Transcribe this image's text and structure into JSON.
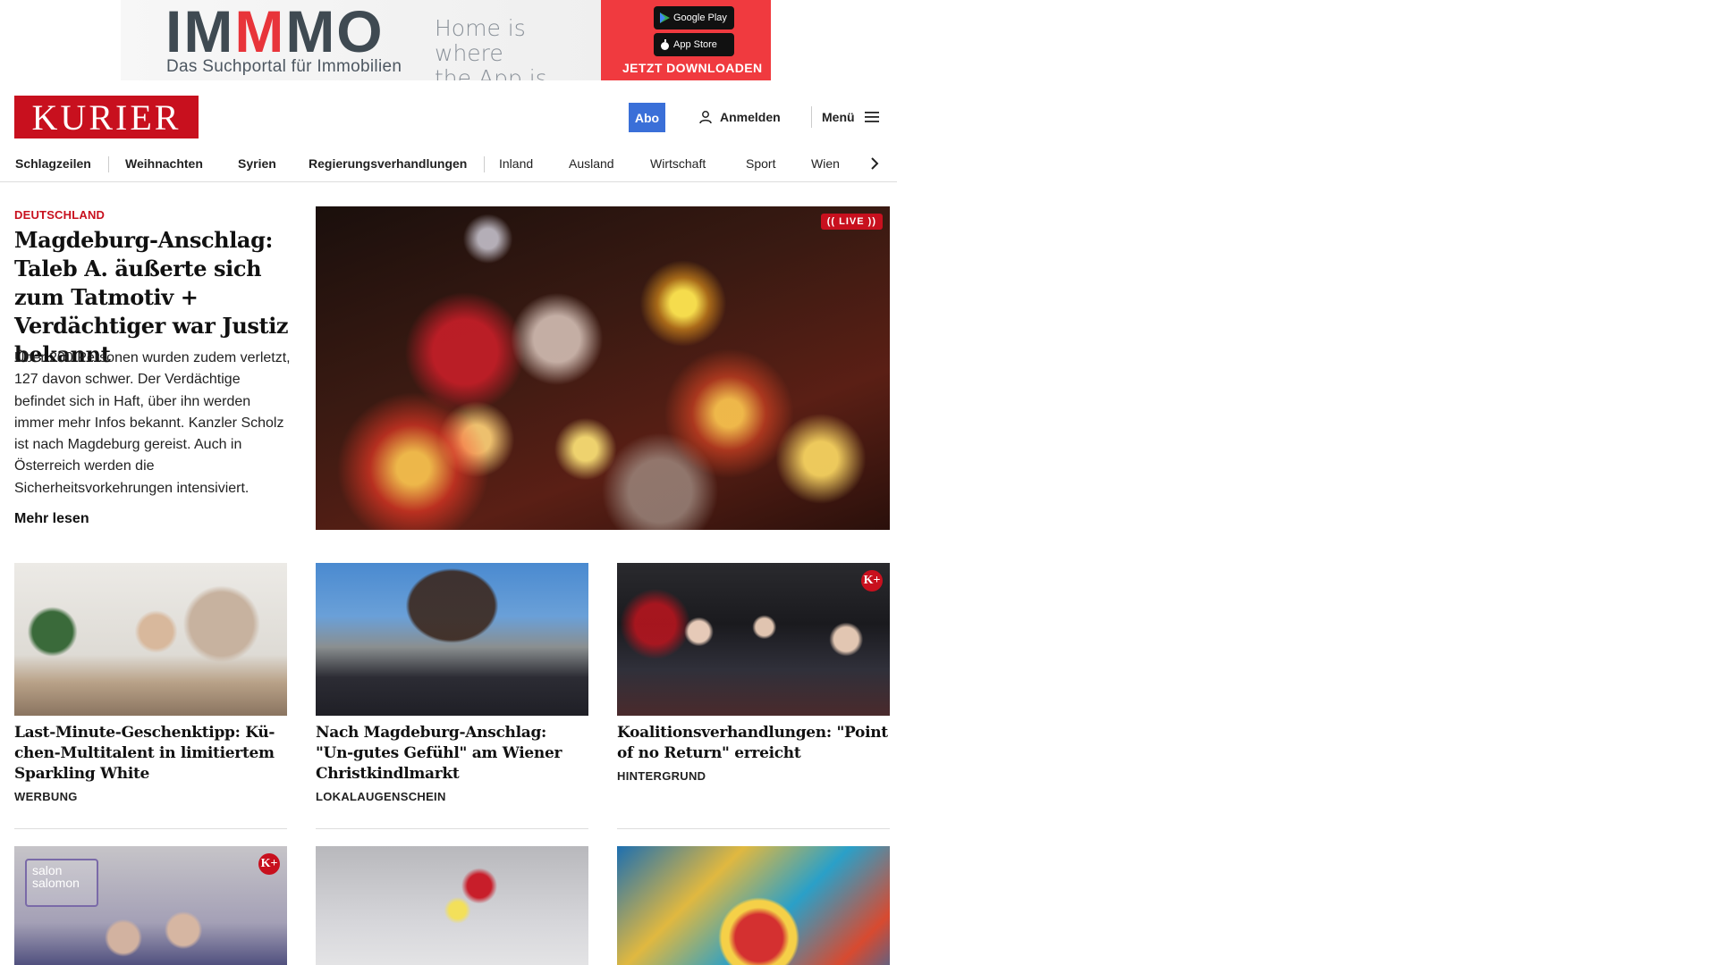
{
  "ad": {
    "logo_pre": "IM",
    "logo_m": "M",
    "logo_post": "MO",
    "subline": "Das Suchportal für Immobilien",
    "slogan_line1": "Home is where",
    "slogan_line2": "the App is.",
    "google_play": "Google Play",
    "app_store": "App Store",
    "cta": "JETZT DOWNLOADEN",
    "brand_color": "#f03a3f"
  },
  "header": {
    "logo": "KURIER",
    "abo_label": "Abo",
    "login_label": "Anmelden",
    "menu_label": "Menü",
    "brand_color": "#c8101e",
    "abo_color": "#3a6fd8"
  },
  "nav": {
    "items": [
      "Schlagzeilen",
      "Weihnachten",
      "Syrien",
      "Regierungsverhandlungen",
      "Inland",
      "Ausland",
      "Wirtschaft",
      "Sport",
      "Wien"
    ]
  },
  "lead": {
    "kicker": "DEUTSCHLAND",
    "title": "Magdeburg-Anschlag: Taleb A. äußerte sich zum Tatmotiv + Verdächtiger war Justiz bekannt",
    "teaser": "Über 200 Personen wurden zudem verletzt, 127 davon schwer. Der Verdächtige befindet sich in Haft, über ihn werden immer mehr Infos bekannt. Kanzler Scholz ist nach Magdeburg gereist. Auch in Österreich werden die Sicherheitsvorkehrungen intensiviert.",
    "more": "Mehr lesen",
    "live_badge": "LIVE"
  },
  "cards": [
    {
      "title": "Last-Minute-Geschenktipp: Kü-chen-Multitalent in limitiertem Sparkling White",
      "tag": "WERBUNG"
    },
    {
      "title": "Nach Magdeburg-Anschlag: \"Un-gutes Gefühl\" am Wiener Christkindlmarkt",
      "tag": "LOKALAUGENSCHEIN"
    },
    {
      "title": "Koalitionsverhandlungen: \"Point of no Return\" erreicht",
      "tag": "HINTERGRUND",
      "badge": "K+"
    }
  ],
  "row2": [
    {
      "badge": "K+",
      "overlay": "salon salomon"
    },
    {},
    {}
  ]
}
